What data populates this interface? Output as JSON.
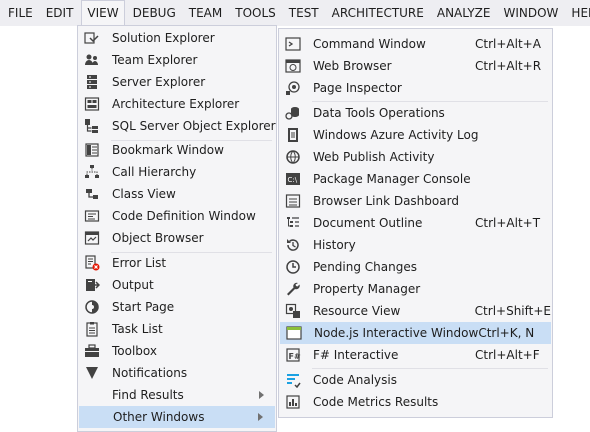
{
  "menubar": {
    "items": [
      "FILE",
      "EDIT",
      "VIEW",
      "DEBUG",
      "TEAM",
      "TOOLS",
      "TEST",
      "ARCHITECTURE",
      "ANALYZE",
      "WINDOW",
      "HELP"
    ],
    "active": "VIEW"
  },
  "view_menu": {
    "items": [
      {
        "label": "Solution Explorer",
        "icon": "solution-explorer-icon"
      },
      {
        "label": "Team Explorer",
        "icon": "team-explorer-icon"
      },
      {
        "label": "Server Explorer",
        "icon": "server-explorer-icon"
      },
      {
        "label": "Architecture Explorer",
        "icon": "architecture-explorer-icon"
      },
      {
        "label": "SQL Server Object Explorer",
        "icon": "sql-server-icon"
      },
      {
        "label": "Bookmark Window",
        "icon": "bookmark-icon"
      },
      {
        "label": "Call Hierarchy",
        "icon": "call-hierarchy-icon"
      },
      {
        "label": "Class View",
        "icon": "class-view-icon"
      },
      {
        "label": "Code Definition Window",
        "icon": "code-definition-icon"
      },
      {
        "label": "Object Browser",
        "icon": "object-browser-icon"
      },
      {
        "label": "Error List",
        "icon": "error-list-icon"
      },
      {
        "label": "Output",
        "icon": "output-icon"
      },
      {
        "label": "Start Page",
        "icon": "start-page-icon"
      },
      {
        "label": "Task List",
        "icon": "task-list-icon"
      },
      {
        "label": "Toolbox",
        "icon": "toolbox-icon"
      },
      {
        "label": "Notifications",
        "icon": "notifications-icon"
      },
      {
        "label": "Find Results",
        "icon": "",
        "submenu": true
      },
      {
        "label": "Other Windows",
        "icon": "",
        "submenu": true,
        "highlighted": true
      }
    ]
  },
  "other_windows_menu": {
    "items": [
      {
        "label": "Command Window",
        "shortcut": "Ctrl+Alt+A",
        "icon": "command-window-icon"
      },
      {
        "label": "Web Browser",
        "shortcut": "Ctrl+Alt+R",
        "icon": "web-browser-icon"
      },
      {
        "label": "Page Inspector",
        "shortcut": "",
        "icon": "page-inspector-icon"
      },
      {
        "label": "Data Tools Operations",
        "shortcut": "",
        "icon": "data-tools-icon"
      },
      {
        "label": "Windows Azure Activity Log",
        "shortcut": "",
        "icon": "azure-log-icon"
      },
      {
        "label": "Web Publish Activity",
        "shortcut": "",
        "icon": "web-publish-icon"
      },
      {
        "label": "Package Manager Console",
        "shortcut": "",
        "icon": "package-manager-icon"
      },
      {
        "label": "Browser Link Dashboard",
        "shortcut": "",
        "icon": "browser-link-icon"
      },
      {
        "label": "Document Outline",
        "shortcut": "Ctrl+Alt+T",
        "icon": "document-outline-icon"
      },
      {
        "label": "History",
        "shortcut": "",
        "icon": "history-icon"
      },
      {
        "label": "Pending Changes",
        "shortcut": "",
        "icon": "pending-changes-icon"
      },
      {
        "label": "Property Manager",
        "shortcut": "",
        "icon": "property-manager-icon"
      },
      {
        "label": "Resource View",
        "shortcut": "Ctrl+Shift+E",
        "icon": "resource-view-icon"
      },
      {
        "label": "Node.js Interactive Window",
        "shortcut": "Ctrl+K, N",
        "icon": "nodejs-window-icon",
        "highlighted": true
      },
      {
        "label": "F# Interactive",
        "shortcut": "Ctrl+Alt+F",
        "icon": "fsharp-icon"
      },
      {
        "label": "Code Analysis",
        "shortcut": "",
        "icon": "code-analysis-icon"
      },
      {
        "label": "Code Metrics Results",
        "shortcut": "",
        "icon": "code-metrics-icon"
      }
    ]
  }
}
